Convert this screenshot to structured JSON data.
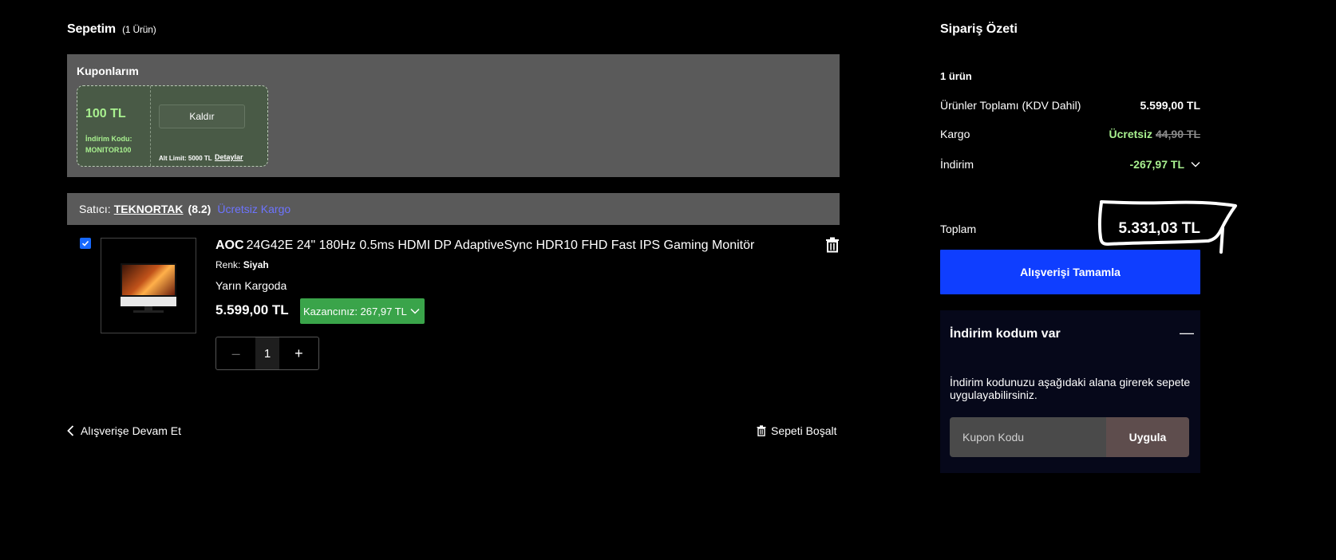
{
  "cart": {
    "title": "Sepetim",
    "count_label": "(1 Ürün)"
  },
  "coupons": {
    "title": "Kuponlarım",
    "amount": "100 TL",
    "code_label": "İndirim Kodu:",
    "code": "MONITOR100",
    "remove_label": "Kaldır",
    "limit_label": "Alt Limit: 5000 TL",
    "details_label": "Detaylar"
  },
  "seller": {
    "label": "Satıcı:",
    "name": "TEKNORTAK",
    "rating": "(8.2)",
    "shipping": "Ücretsiz Kargo"
  },
  "product": {
    "brand": "AOC",
    "name": "24G42E 24\" 180Hz 0.5ms HDMI DP AdaptiveSync HDR10 FHD Fast IPS Gaming Monitör",
    "color_label": "Renk:",
    "color_value": "Siyah",
    "delivery": "Yarın Kargoda",
    "price": "5.599,00 TL",
    "savings": "Kazancınız: 267,97 TL",
    "quantity": "1",
    "minus": "–",
    "plus": "+"
  },
  "footer": {
    "continue_label": "Alışverişe Devam Et",
    "empty_label": "Sepeti Boşalt"
  },
  "summary": {
    "title": "Sipariş Özeti",
    "item_count": "1 ürün",
    "products_label": "Ürünler Toplamı (KDV Dahil)",
    "products_value": "5.599,00 TL",
    "cargo_label": "Kargo",
    "cargo_free": "Ücretsiz",
    "cargo_old": "44,90 TL",
    "discount_label": "İndirim",
    "discount_value": "-267,97 TL",
    "total_label": "Toplam",
    "total_value": "5.331,03 TL",
    "checkout_label": "Alışverişi Tamamla"
  },
  "promo": {
    "title": "İndirim kodum var",
    "toggle": "—",
    "description": "İndirim kodunuzu aşağıdaki alana girerek sepete uygulayabilirsiniz.",
    "input_placeholder": "Kupon Kodu",
    "apply_label": "Uygula"
  },
  "colors": {
    "accent_blue": "#0f3eff",
    "savings_green": "#3aa44a",
    "discount_green": "#a8f08f",
    "panel_gray": "#5a5a5a",
    "link_purple": "#6d74ff"
  }
}
